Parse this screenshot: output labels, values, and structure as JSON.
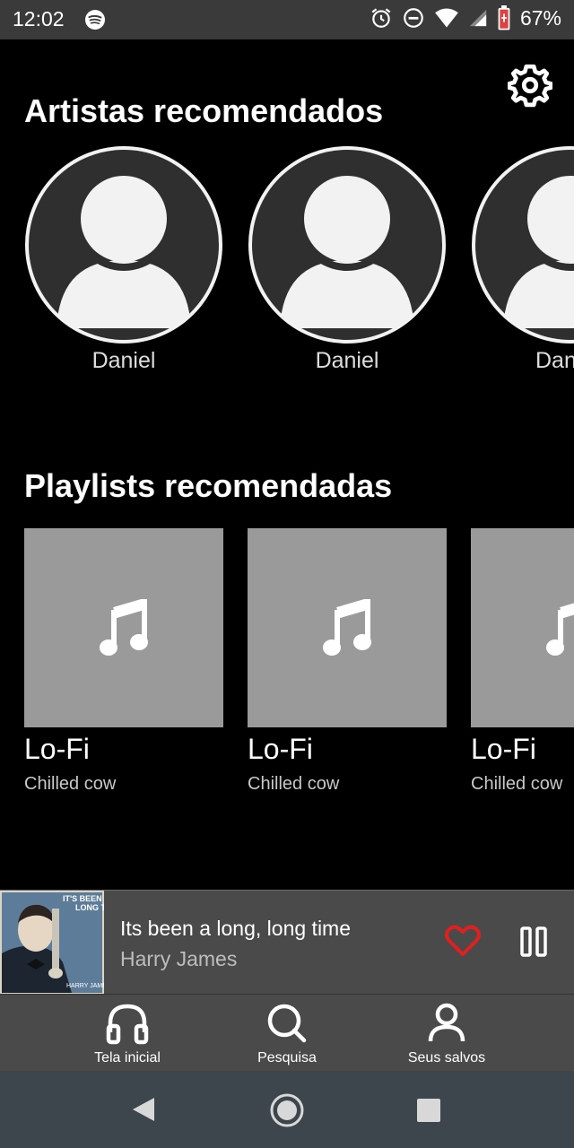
{
  "status_bar": {
    "time": "12:02",
    "battery": "67%",
    "icons": [
      "spotify-icon",
      "alarm-icon",
      "dnd-icon",
      "wifi-icon",
      "signal-icon",
      "battery-icon"
    ]
  },
  "header": {
    "settings_icon": "gear-icon"
  },
  "artists_section": {
    "title": "Artistas recomendados",
    "items": [
      {
        "name": "Daniel"
      },
      {
        "name": "Daniel"
      },
      {
        "name": "Dan"
      }
    ]
  },
  "playlists_section": {
    "title": "Playlists recomendadas",
    "items": [
      {
        "title": "Lo-Fi",
        "subtitle": "Chilled cow"
      },
      {
        "title": "Lo-Fi",
        "subtitle": "Chilled cow"
      },
      {
        "title": "Lo-Fi",
        "subtitle": "Chilled cow"
      }
    ]
  },
  "now_playing": {
    "title": "Its been a long, long time",
    "artist": "Harry James",
    "liked": true,
    "heart_color": "#e0201f",
    "state": "playing"
  },
  "bottom_nav": {
    "items": [
      {
        "label": "Tela inicial",
        "icon": "headphones-icon"
      },
      {
        "label": "Pesquisa",
        "icon": "search-icon"
      },
      {
        "label": "Seus salvos",
        "icon": "person-icon"
      }
    ]
  },
  "system_nav": {
    "icons": [
      "back-icon",
      "home-icon",
      "recents-icon"
    ]
  }
}
